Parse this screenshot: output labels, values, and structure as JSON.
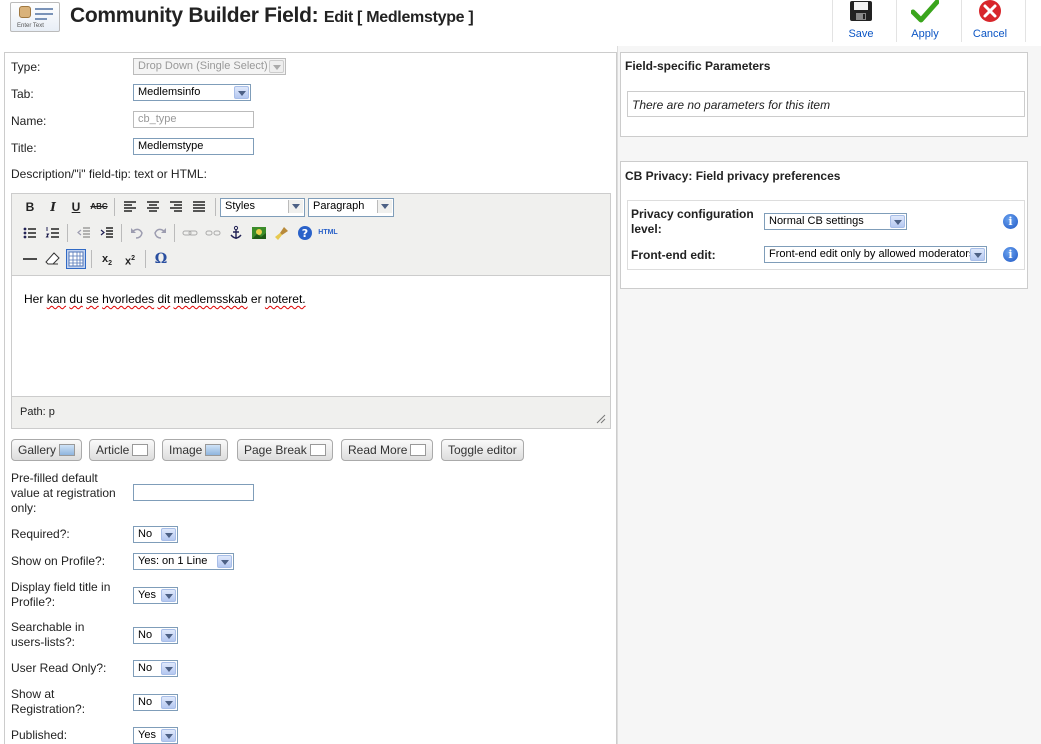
{
  "header": {
    "title": "Community Builder Field:",
    "subtitle": "Edit [ Medlemstype ]",
    "icon_caption": "Enter Text",
    "toolbar": {
      "save_label": "Save",
      "apply_label": "Apply",
      "cancel_label": "Cancel"
    }
  },
  "form": {
    "type": {
      "label": "Type:",
      "value": "Drop Down (Single Select)"
    },
    "tab": {
      "label": "Tab:",
      "value": "Medlemsinfo"
    },
    "name": {
      "label": "Name:",
      "value": "cb_type"
    },
    "title": {
      "label": "Title:",
      "value": "Medlemstype"
    },
    "description": {
      "label": "Description/\"i\" field-tip: text or HTML:"
    }
  },
  "editor": {
    "styles_label": "Styles",
    "paragraph_label": "Paragraph",
    "content_words": [
      "Her",
      "kan",
      "du",
      "se",
      "hvorledes",
      "dit",
      "medlemsskab",
      "er",
      "noteret."
    ],
    "path_label": "Path: p",
    "buttons": {
      "gallery": "Gallery",
      "article": "Article",
      "image": "Image",
      "page_break": "Page Break",
      "read_more": "Read More",
      "toggle": "Toggle editor"
    },
    "icons": [
      "bold-icon",
      "italic-icon",
      "underline-icon",
      "strikethrough-icon",
      "align-left-icon",
      "align-center-icon",
      "align-right-icon",
      "align-justify-icon",
      "bullet-list-icon",
      "numbered-list-icon",
      "outdent-icon",
      "indent-icon",
      "undo-icon",
      "redo-icon",
      "link-icon",
      "unlink-icon",
      "anchor-icon",
      "image-icon",
      "cleanup-icon",
      "help-icon",
      "html-icon",
      "horizontal-rule-icon",
      "eraser-icon",
      "table-icon",
      "subscript-icon",
      "superscript-icon",
      "omega-icon"
    ]
  },
  "options": {
    "prefilled": {
      "label_lines": [
        "Pre-filled default",
        "value at registration",
        "only:"
      ],
      "value": ""
    },
    "required": {
      "label": "Required?:",
      "value": "No"
    },
    "show_on_profile": {
      "label": "Show on Profile?:",
      "value": "Yes: on 1 Line"
    },
    "display_title": {
      "label_lines": [
        "Display field title in",
        "Profile?:"
      ],
      "value": "Yes"
    },
    "searchable": {
      "label_lines": [
        "Searchable in",
        "users-lists?:"
      ],
      "value": "No"
    },
    "read_only": {
      "label": "User Read Only?:",
      "value": "No"
    },
    "show_registration": {
      "label_lines": [
        "Show at",
        "Registration?:"
      ],
      "value": "No"
    },
    "published": {
      "label": "Published:",
      "value": "Yes"
    }
  },
  "field_params": {
    "title": "Field-specific Parameters",
    "empty_text": "There are no parameters for this item"
  },
  "privacy": {
    "title": "CB Privacy: Field privacy preferences",
    "config_label_lines": [
      "Privacy configuration",
      "level:"
    ],
    "config_value": "Normal CB settings",
    "frontend_label": "Front-end edit:",
    "frontend_value": "Front-end edit only by allowed moderators",
    "info_glyph": "i"
  }
}
